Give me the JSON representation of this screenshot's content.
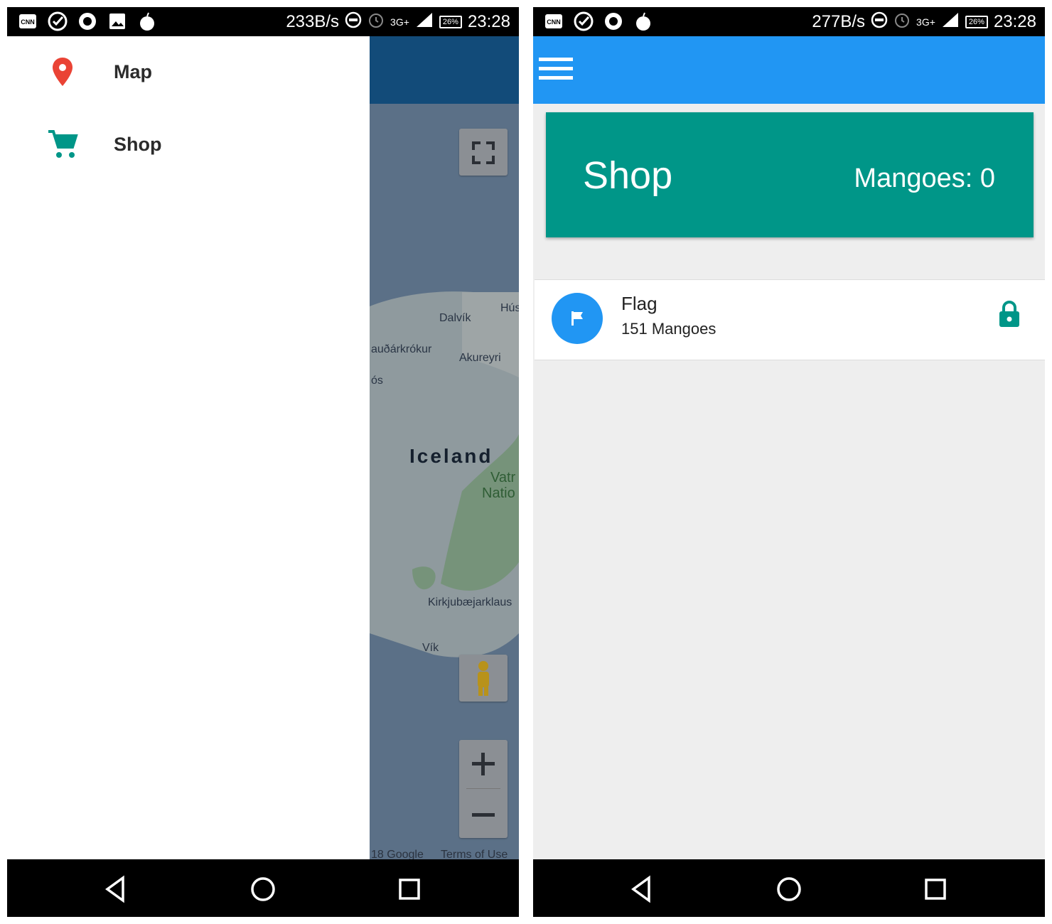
{
  "left": {
    "statusbar": {
      "speed": "233B/s",
      "network": "3G+",
      "battery": "26%",
      "time": "23:28"
    },
    "drawer": {
      "items": [
        {
          "label": "Map",
          "icon": "map-marker-icon",
          "color": "#ea4335"
        },
        {
          "label": "Shop",
          "icon": "cart-icon",
          "color": "#009688"
        }
      ]
    },
    "map": {
      "labels": [
        "Dalvík",
        "Hús",
        "auðárkrókur",
        "Akureyri",
        "ós",
        "Iceland",
        "Vatr",
        "Natio",
        "Kirkjubæjarklaus",
        "Vík"
      ],
      "credit": "18 Google",
      "terms": "Terms of Use"
    }
  },
  "right": {
    "statusbar": {
      "speed": "277B/s",
      "network": "3G+",
      "battery": "26%",
      "time": "23:28"
    },
    "appbar_color": "#2196f3",
    "shop_header": {
      "title": "Shop",
      "count_label": "Mangoes: 0",
      "color": "#009688"
    },
    "items": [
      {
        "name": "Flag",
        "price": "151 Mangoes",
        "icon": "flag-icon",
        "locked": true,
        "lock_icon": "lock-icon"
      }
    ]
  }
}
